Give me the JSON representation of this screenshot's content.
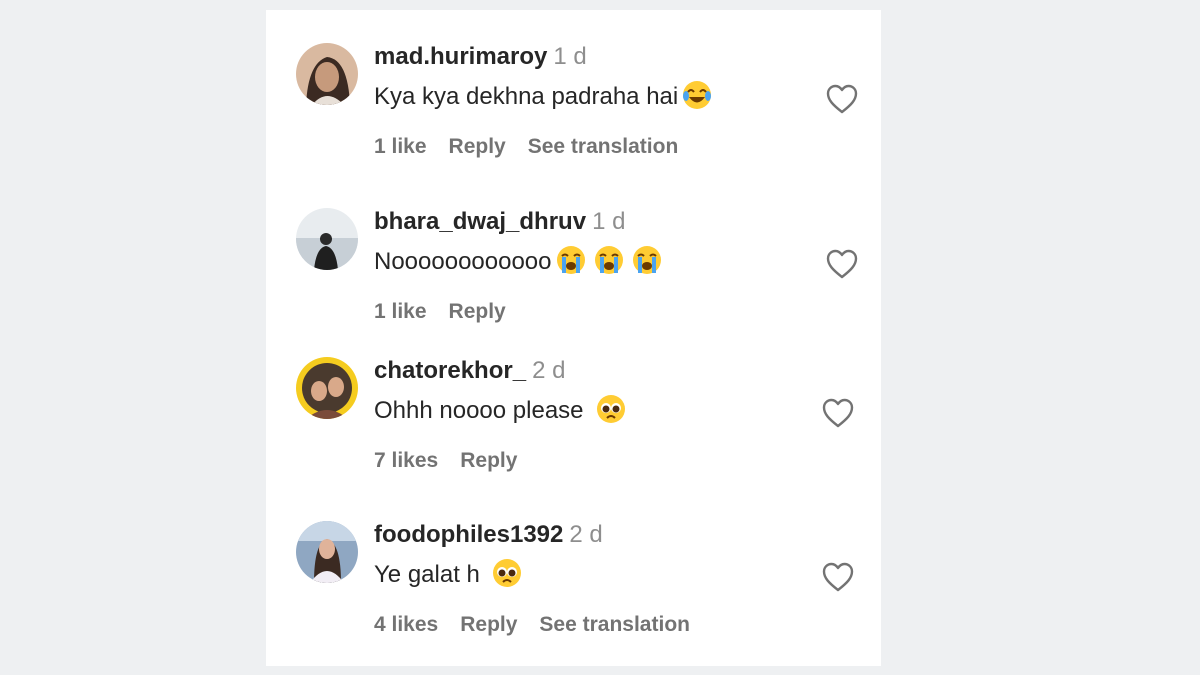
{
  "comments": [
    {
      "username": "mad.hurimaroy",
      "time": "1 d",
      "text": "Kya kya dekhna padraha hai",
      "emoji": [
        "laughing-tears-emoji"
      ],
      "likes": "1 like",
      "reply": "Reply",
      "translation": "See translation"
    },
    {
      "username": "bhara_dwaj_dhruv",
      "time": "1 d",
      "text": "Noooooooooooo",
      "emoji": [
        "crying-emoji",
        "crying-emoji",
        "crying-emoji"
      ],
      "likes": "1 like",
      "reply": "Reply"
    },
    {
      "username": "chatorekhor_",
      "time": "2 d",
      "text": "Ohhh noooo please",
      "emoji": [
        "pleading-emoji"
      ],
      "likes": "7 likes",
      "reply": "Reply"
    },
    {
      "username": "foodophiles1392",
      "time": "2 d",
      "text": "Ye galat h",
      "emoji": [
        "pleading-emoji"
      ],
      "likes": "4 likes",
      "reply": "Reply",
      "translation": "See translation"
    }
  ],
  "colors": {
    "text": "#262626",
    "muted": "#8e8e8e",
    "panel": "#ffffff",
    "background": "#eef0f2"
  }
}
